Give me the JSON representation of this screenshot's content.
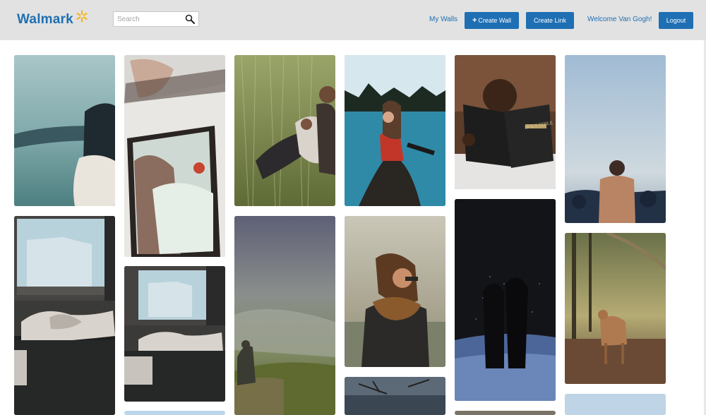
{
  "navbar": {
    "brand": "Walmark",
    "search": {
      "placeholder": "Search",
      "value": ""
    },
    "my_walls": "My Walls",
    "create_wall": "Create Wall",
    "create_link": "Create Link",
    "welcome": "Welcome Van Gogh!",
    "logout": "Logout"
  },
  "colors": {
    "navbar_bg": "#e2e2e2",
    "brand_blue": "#1e6fb3",
    "spark_yellow": "#f5b41e"
  },
  "icons": {
    "search": "search-icon",
    "spark": "spark-icon",
    "plus": "plus-icon"
  },
  "photos": [
    {
      "name": "photo-woman-hat-scarf-sea"
    },
    {
      "name": "photo-woman-in-mirror"
    },
    {
      "name": "photo-couple-in-grass"
    },
    {
      "name": "photo-woman-in-canoe-lake"
    },
    {
      "name": "photo-child-reading-bible",
      "text": "HOLY BIBLE"
    },
    {
      "name": "photo-shirtless-man-by-sea"
    },
    {
      "name": "photo-person-lying-on-sofa-window"
    },
    {
      "name": "photo-person-lying-on-sofa-window-small"
    },
    {
      "name": "photo-person-on-mountain-fog"
    },
    {
      "name": "photo-woman-scarf-sunglasses"
    },
    {
      "name": "photo-couple-kissing-night"
    },
    {
      "name": "photo-fawn-in-forest"
    },
    {
      "name": "photo-sky-partial"
    },
    {
      "name": "photo-branches-water-partial"
    },
    {
      "name": "photo-brown-partial"
    },
    {
      "name": "photo-sky-blue-partial"
    }
  ]
}
